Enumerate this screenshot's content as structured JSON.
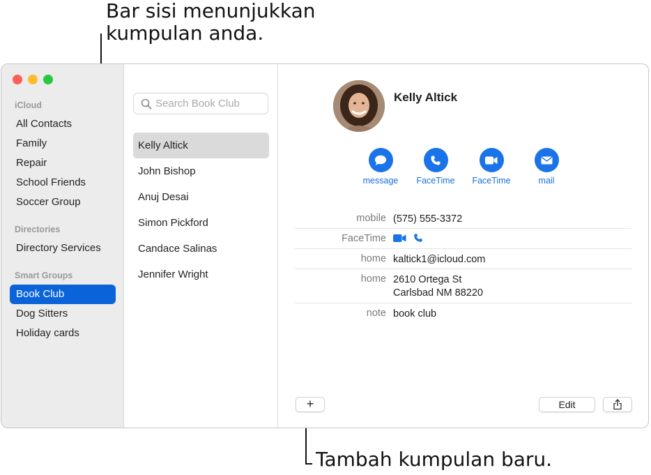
{
  "callouts": {
    "sidebar_line1": "Bar sisi menunjukkan",
    "sidebar_line2": "kumpulan anda.",
    "add_group": "Tambah kumpulan baru."
  },
  "sidebar": {
    "sections": [
      {
        "title": "iCloud",
        "items": [
          "All Contacts",
          "Family",
          "Repair",
          "School Friends",
          "Soccer Group"
        ]
      },
      {
        "title": "Directories",
        "items": [
          "Directory Services"
        ]
      },
      {
        "title": "Smart Groups",
        "items": [
          "Book Club",
          "Dog Sitters",
          "Holiday cards"
        ]
      }
    ],
    "selected": "Book Club"
  },
  "search": {
    "placeholder": "Search Book Club",
    "value": ""
  },
  "contacts": [
    "Kelly Altick",
    "John Bishop",
    "Anuj Desai",
    "Simon Pickford",
    "Candace Salinas",
    "Jennifer Wright"
  ],
  "selected_contact": "Kelly Altick",
  "detail": {
    "name": "Kelly Altick",
    "actions": [
      {
        "icon": "message-icon",
        "label": "message"
      },
      {
        "icon": "phone-icon",
        "label": "FaceTime"
      },
      {
        "icon": "video-icon",
        "label": "FaceTime"
      },
      {
        "icon": "mail-icon",
        "label": "mail"
      }
    ],
    "fields": {
      "mobile_label": "mobile",
      "mobile_value": "(575) 555-3372",
      "facetime_label": "FaceTime",
      "email_label": "home",
      "email_value": "kaltick1@icloud.com",
      "address_label": "home",
      "address_line1": "2610 Ortega St",
      "address_line2": "Carlsbad NM 88220",
      "note_label": "note",
      "note_value": "book club"
    }
  },
  "toolbar": {
    "add_label": "+",
    "edit_label": "Edit",
    "share_icon": "share-icon"
  },
  "colors": {
    "accent": "#0a63d8",
    "link": "#1a73e8",
    "selection_gray": "#dadada"
  }
}
